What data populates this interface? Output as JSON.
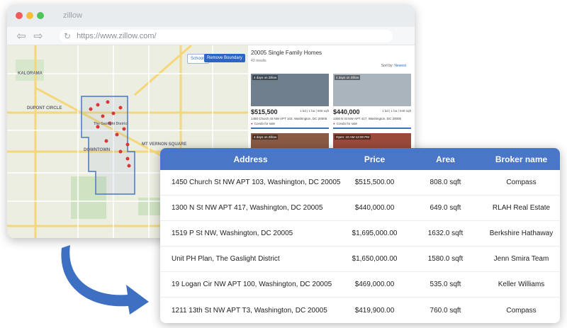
{
  "browser": {
    "tab_title": "zillow",
    "url": "https://www.zillow.com/",
    "back_glyph": "⇦",
    "forward_glyph": "⇨",
    "reload_glyph": "↻"
  },
  "map": {
    "schools_label": "Schools",
    "remove_boundary_label": "Remove Boundary",
    "labels": [
      "KALORAMA",
      "DUPONT CIRCLE",
      "DOWNTOWN",
      "MT VERNON SQUARE",
      "The Gaslight District"
    ]
  },
  "listings": {
    "title": "20005 Single Family Homes",
    "count": "43 results",
    "sort_label": "Sort by:",
    "sort_value": "Newest",
    "cards": [
      {
        "badge": "4 days on Zillow",
        "price": "$515,500",
        "specs": "1 bd | 1 ba | 808 sqft",
        "address": "1450 Church St NW APT 103, Washington, DC 20005",
        "status": "Condo for sale"
      },
      {
        "badge": "4 days on Zillow",
        "price": "$440,000",
        "specs": "1 bd | 1 ba | 649 sqft",
        "address": "1300 N St NW APT 417, Washington, DC 20005",
        "status": "Condo for sale"
      },
      {
        "badge": "4 days on Zillow",
        "price": "",
        "specs": "",
        "address": "",
        "status": ""
      },
      {
        "badge": "Open: 10 AM-12:00 PM",
        "price": "",
        "specs": "",
        "address": "",
        "status": ""
      }
    ]
  },
  "table": {
    "headers": {
      "address": "Address",
      "price": "Price",
      "area": "Area",
      "broker": "Broker name"
    },
    "rows": [
      {
        "address": "1450 Church St NW APT 103, Washington, DC 20005",
        "price": "$515,500.00",
        "area": "808.0 sqft",
        "broker": "Compass"
      },
      {
        "address": "1300 N St NW APT 417, Washington, DC 20005",
        "price": "$440,000.00",
        "area": "649.0 sqft",
        "broker": "RLAH Real Estate"
      },
      {
        "address": "1519 P St NW, Washington, DC 20005",
        "price": "$1,695,000.00",
        "area": "1632.0 sqft",
        "broker": "Berkshire Hathaway"
      },
      {
        "address": "Unit PH Plan, The Gaslight District",
        "price": "$1,650,000.00",
        "area": "1580.0 sqft",
        "broker": "Jenn Smira Team"
      },
      {
        "address": "19 Logan Cir NW APT 100, Washington, DC 20005",
        "price": "$469,000.00",
        "area": "535.0 sqft",
        "broker": "Keller Williams"
      },
      {
        "address": "1211 13th St NW APT T3, Washington, DC 20005",
        "price": "$419,900.00",
        "area": "760.0 sqft",
        "broker": "Compass"
      }
    ]
  },
  "colors": {
    "header_blue": "#4a76c7",
    "arrow_blue": "#3d6fc2",
    "map_pin": "#d93636"
  }
}
